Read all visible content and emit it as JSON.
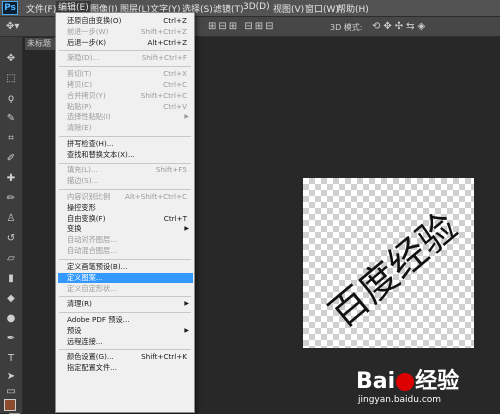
{
  "app": {
    "logo": "Ps"
  },
  "menubar": [
    {
      "label": "文件(F)",
      "active": false
    },
    {
      "label": "编辑(E)",
      "active": true
    },
    {
      "label": "图像(I)",
      "active": false
    },
    {
      "label": "图层(L)",
      "active": false
    },
    {
      "label": "文字(Y)",
      "active": false
    },
    {
      "label": "选择(S)",
      "active": false
    },
    {
      "label": "滤镜(T)",
      "active": false
    },
    {
      "label": "3D(D)",
      "active": false
    },
    {
      "label": "视图(V)",
      "active": false
    },
    {
      "label": "窗口(W)",
      "active": false
    },
    {
      "label": "帮助(H)",
      "active": false
    }
  ],
  "options_bar": {
    "mode_3d": "3D 模式:"
  },
  "document": {
    "tab_label": "未标题",
    "canvas_text": "百度经验"
  },
  "edit_menu": [
    {
      "type": "item",
      "label": "还原自由变换(O)",
      "shortcut": "Ctrl+Z",
      "disabled": false
    },
    {
      "type": "item",
      "label": "前进一步(W)",
      "shortcut": "Shift+Ctrl+Z",
      "disabled": true
    },
    {
      "type": "item",
      "label": "后退一步(K)",
      "shortcut": "Alt+Ctrl+Z",
      "disabled": false
    },
    {
      "type": "sep"
    },
    {
      "type": "item",
      "label": "渐隐(D)...",
      "shortcut": "Shift+Ctrl+F",
      "disabled": true
    },
    {
      "type": "sep"
    },
    {
      "type": "item",
      "label": "剪切(T)",
      "shortcut": "Ctrl+X",
      "disabled": true
    },
    {
      "type": "item",
      "label": "拷贝(C)",
      "shortcut": "Ctrl+C",
      "disabled": true
    },
    {
      "type": "item",
      "label": "合并拷贝(Y)",
      "shortcut": "Shift+Ctrl+C",
      "disabled": true
    },
    {
      "type": "item",
      "label": "粘贴(P)",
      "shortcut": "Ctrl+V",
      "disabled": true
    },
    {
      "type": "item",
      "label": "选择性粘贴(I)",
      "shortcut": "",
      "disabled": true,
      "submenu": true
    },
    {
      "type": "item",
      "label": "清除(E)",
      "shortcut": "",
      "disabled": true
    },
    {
      "type": "sep"
    },
    {
      "type": "item",
      "label": "拼写检查(H)...",
      "shortcut": "",
      "disabled": false
    },
    {
      "type": "item",
      "label": "查找和替换文本(X)...",
      "shortcut": "",
      "disabled": false
    },
    {
      "type": "sep"
    },
    {
      "type": "item",
      "label": "填充(L)...",
      "shortcut": "Shift+F5",
      "disabled": true
    },
    {
      "type": "item",
      "label": "描边(S)...",
      "shortcut": "",
      "disabled": true
    },
    {
      "type": "sep"
    },
    {
      "type": "item",
      "label": "内容识别比例",
      "shortcut": "Alt+Shift+Ctrl+C",
      "disabled": true
    },
    {
      "type": "item",
      "label": "操控变形",
      "shortcut": "",
      "disabled": false
    },
    {
      "type": "item",
      "label": "自由变换(F)",
      "shortcut": "Ctrl+T",
      "disabled": false
    },
    {
      "type": "item",
      "label": "变换",
      "shortcut": "",
      "disabled": false,
      "submenu": true
    },
    {
      "type": "item",
      "label": "自动对齐图层...",
      "shortcut": "",
      "disabled": true
    },
    {
      "type": "item",
      "label": "自动混合图层...",
      "shortcut": "",
      "disabled": true
    },
    {
      "type": "sep"
    },
    {
      "type": "item",
      "label": "定义画笔预设(B)...",
      "shortcut": "",
      "disabled": false
    },
    {
      "type": "item",
      "label": "定义图案...",
      "shortcut": "",
      "disabled": false,
      "highlighted": true
    },
    {
      "type": "item",
      "label": "定义自定形状...",
      "shortcut": "",
      "disabled": true
    },
    {
      "type": "sep"
    },
    {
      "type": "item",
      "label": "清理(R)",
      "shortcut": "",
      "disabled": false,
      "submenu": true
    },
    {
      "type": "sep"
    },
    {
      "type": "item",
      "label": "Adobe PDF 预设...",
      "shortcut": "",
      "disabled": false
    },
    {
      "type": "item",
      "label": "预设",
      "shortcut": "",
      "disabled": false,
      "submenu": true
    },
    {
      "type": "item",
      "label": "远程连接...",
      "shortcut": "",
      "disabled": false
    },
    {
      "type": "sep"
    },
    {
      "type": "item",
      "label": "颜色设置(G)...",
      "shortcut": "Shift+Ctrl+K",
      "disabled": false
    },
    {
      "type": "item",
      "label": "指定配置文件...",
      "shortcut": "",
      "disabled": false
    }
  ],
  "watermark": {
    "logo_left": "Bai",
    "logo_right": "经验",
    "url": "jingyan.baidu.com"
  },
  "colors": {
    "highlight": "#3399ff",
    "ps_blue": "#4fb3ff",
    "baidu_red": "#dd0000"
  }
}
